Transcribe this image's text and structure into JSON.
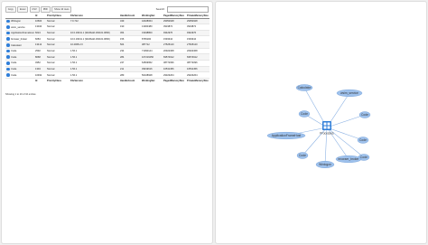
{
  "toolbar": {
    "buttons": [
      "Copy",
      "Excel",
      "CSV",
      "PDF",
      "Show 10 rows"
    ],
    "search_label": "Search:",
    "search_value": ""
  },
  "table": {
    "columns": [
      "",
      "Id",
      "PriorityClass",
      "FileVersion",
      "HandleCount",
      "WorkingSet",
      "PagedMemorySize",
      "PrivateMemorySize"
    ],
    "rows": [
      {
        "name": "Winlogon",
        "id": "10600",
        "priority": "Normal",
        "file_version": "7.0.712",
        "handles": "349",
        "working_set": "42328064",
        "paged": "29052928",
        "private": "29052928"
      },
      {
        "name": "wsim_service",
        "id": "13044",
        "priority": "Normal",
        "file_version": "",
        "handles": "190",
        "working_set": "13000480",
        "paged": "3919872",
        "private": "3919872"
      },
      {
        "name": "ApplicationFrameHost",
        "id": "6024",
        "priority": "Normal",
        "file_version": "10.0.19041.1 (WinBuild.160101.0800)",
        "handles": "364",
        "working_set": "31948800",
        "paged": "9342976",
        "private": "9342976"
      },
      {
        "name": "browser_broker",
        "id": "6084",
        "priority": "Normal",
        "file_version": "10.0.19041.1 (WinBuild.160101.0800)",
        "handles": "156",
        "working_set": "8765184",
        "paged": "1593344",
        "private": "1593344"
      },
      {
        "name": "Calculator",
        "id": "13412",
        "priority": "Normal",
        "file_version": "10.2008.2.0",
        "handles": "504",
        "working_set": "387712",
        "paged": "27525120",
        "private": "27525120"
      },
      {
        "name": "Code",
        "id": "2592",
        "priority": "Normal",
        "file_version": "1.56.1",
        "handles": "234",
        "working_set": "71090144",
        "paged": "20922368",
        "private": "20922368"
      },
      {
        "name": "Code",
        "id": "8068",
        "priority": "Normal",
        "file_version": "1.56.1",
        "handles": "284",
        "working_set": "107216256",
        "paged": "69574912",
        "private": "69574912"
      },
      {
        "name": "Code",
        "id": "4952",
        "priority": "Normal",
        "file_version": "1.56.1",
        "handles": "247",
        "working_set": "64509952",
        "paged": "38772096",
        "private": "38772096"
      },
      {
        "name": "Code",
        "id": "1304",
        "priority": "Normal",
        "file_version": "1.56.1",
        "handles": "211",
        "working_set": "39919616",
        "paged": "16531456",
        "private": "16531456"
      },
      {
        "name": "Code",
        "id": "10932",
        "priority": "Normal",
        "file_version": "1.56.1",
        "handles": "289",
        "working_set": "50108928",
        "paged": "29323264",
        "private": "29323264"
      }
    ],
    "info": "Showing 1 to 10 of 10 entries"
  },
  "graph": {
    "center_label": "Processes",
    "center_color": "#2f7ed8",
    "node_fill": "#9ec1ec",
    "node_stroke": "#6b9bd6",
    "edge_color": "#8fb4e4",
    "nodes": [
      "Calculator",
      "wsim_service",
      "Code",
      "Code",
      "Code",
      "ApplicationFrameHost",
      "Code",
      "Code",
      "Winlogon",
      "browser_broker"
    ]
  }
}
